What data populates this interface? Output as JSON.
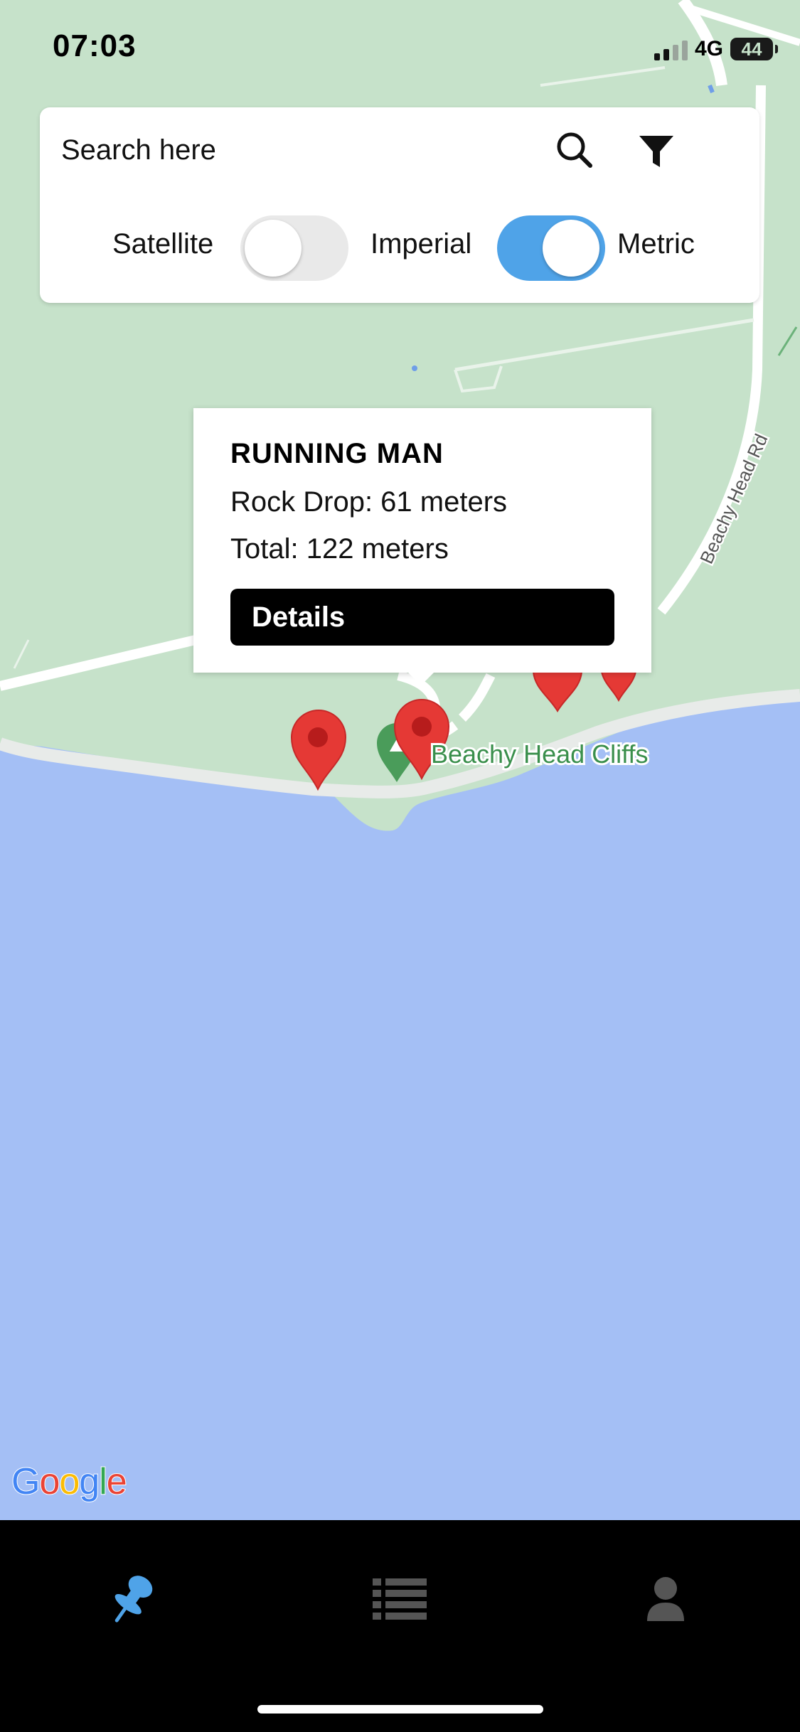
{
  "status_bar": {
    "time": "07:03",
    "network": "4G",
    "battery": "44"
  },
  "search": {
    "placeholder": "Search here",
    "toggles": {
      "satellite_label": "Satellite",
      "imperial_label": "Imperial",
      "metric_label": "Metric",
      "satellite_on": false,
      "metric_on": true
    }
  },
  "map": {
    "road_label": "Beachy Head Rd",
    "place_label": "Beachy Head Cliffs",
    "colors": {
      "land": "#c6e2ca",
      "sea": "#a4bff5",
      "road": "#ffffff",
      "marker": "#e53935"
    }
  },
  "popup": {
    "title": "RUNNING MAN",
    "rock_drop": "Rock Drop: 61 meters",
    "total": "Total: 122 meters",
    "details_label": "Details"
  },
  "attribution": {
    "letters": [
      "G",
      "o",
      "o",
      "g",
      "l",
      "e"
    ]
  },
  "tabs": [
    {
      "icon": "pin-icon"
    },
    {
      "icon": "list-icon"
    },
    {
      "icon": "profile-icon"
    }
  ]
}
